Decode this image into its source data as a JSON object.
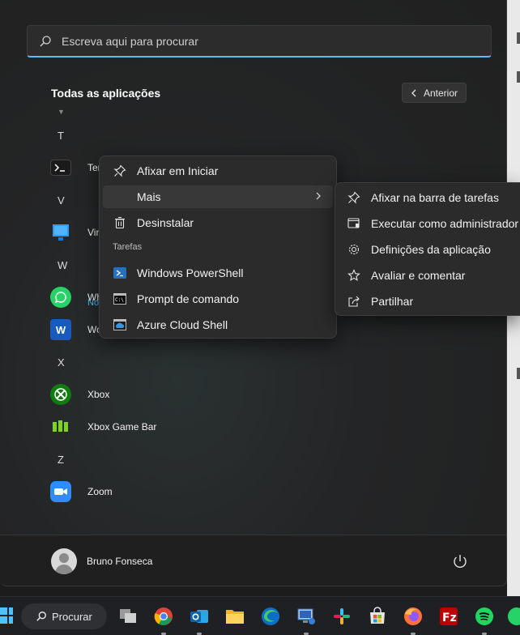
{
  "search": {
    "placeholder": "Escreva aqui para procurar"
  },
  "all_apps": {
    "title": "Todas as aplicações",
    "back_label": "Anterior"
  },
  "letters": [
    "T",
    "V",
    "W",
    "X",
    "Z"
  ],
  "apps": {
    "terminal": "Ter",
    "virtual": "Vir",
    "whatsapp": "Wh",
    "whatsapp_sub": "No",
    "word": "Wo",
    "xbox": "Xbox",
    "xbox_game_bar": "Xbox Game Bar",
    "zoom": "Zoom"
  },
  "context_menu": {
    "pin_start": "Afixar em Iniciar",
    "more": "Mais",
    "uninstall": "Desinstalar",
    "tasks_header": "Tarefas",
    "powershell": "Windows PowerShell",
    "cmd": "Prompt de comando",
    "azure": "Azure Cloud Shell"
  },
  "submenu": {
    "pin_taskbar": "Afixar na barra de tarefas",
    "run_admin": "Executar como administrador",
    "app_settings": "Definições da aplicação",
    "rate_review": "Avaliar e comentar",
    "share": "Partilhar"
  },
  "user": {
    "name": "Bruno Fonseca"
  },
  "taskbar": {
    "search_label": "Procurar"
  },
  "colors": {
    "accent": "#4cc2ff",
    "menu_bg": "#2b2b2b",
    "start_bg": "#202020"
  }
}
